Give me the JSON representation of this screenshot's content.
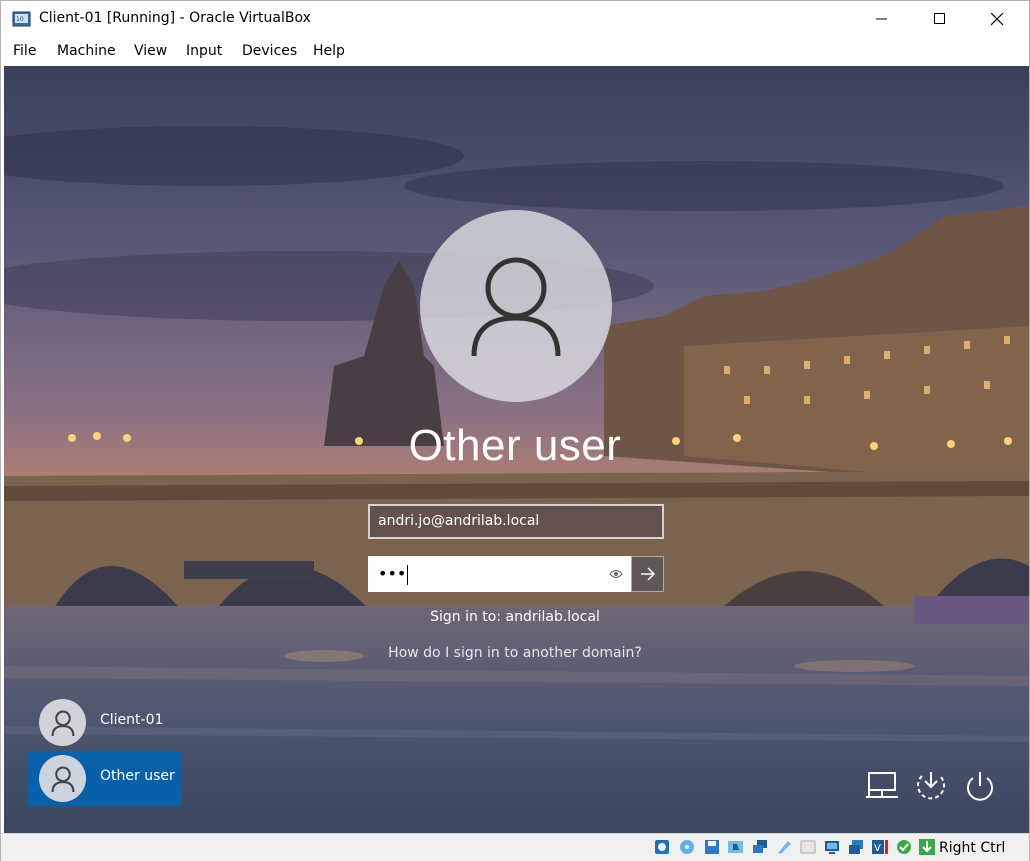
{
  "window": {
    "title": "Client-01 [Running] - Oracle VirtualBox",
    "controls": {
      "minimize": "minimize-icon",
      "maximize": "maximize-icon",
      "close": "close-icon"
    }
  },
  "menu": [
    "File",
    "Machine",
    "View",
    "Input",
    "Devices",
    "Help"
  ],
  "login": {
    "user_name": "Other user",
    "username_value": "andri.jo@andrilab.local",
    "password_mask": "•••",
    "sign_in_to": "Sign in to: andrilab.local",
    "domain_help": "How do I sign in to another domain?"
  },
  "user_tiles": [
    {
      "label": "Client-01",
      "selected": false
    },
    {
      "label": "Other user",
      "selected": true
    }
  ],
  "tray_icons": [
    "network-icon",
    "accessibility-icon",
    "power-icon"
  ],
  "statusbar": {
    "icons": [
      "hard-disk-icon",
      "optical-drive-icon",
      "floppy-icon",
      "audio-icon",
      "network-adapter-icon",
      "usb-icon",
      "shared-folders-icon",
      "display-icon",
      "video-capture-icon",
      "virtualization-icon",
      "guest-additions-icon",
      "mouse-integration-icon",
      "keyboard-icon"
    ],
    "host_key": "Right Ctrl"
  },
  "colors": {
    "selected_tile": "#0064b4",
    "window_bg": "#ffffff"
  }
}
